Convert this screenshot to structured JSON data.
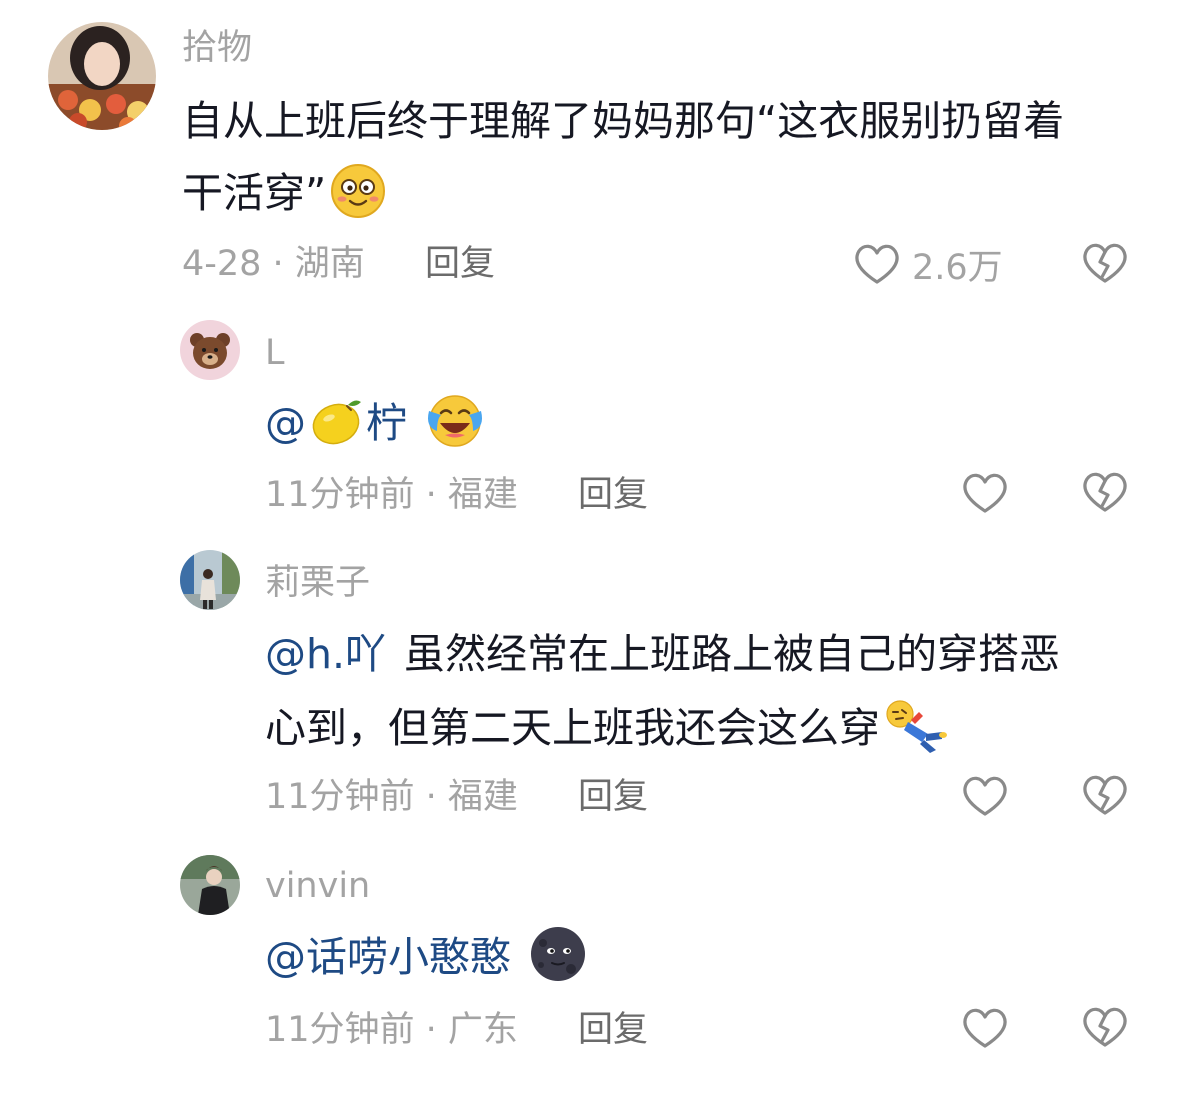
{
  "comments": [
    {
      "username": "拾物",
      "text_line1": "自从上班后终于理解了妈妈那句“这衣服别扔留着",
      "text_line2": "干活穿”",
      "text_emoji": "smiling-face-emoji",
      "meta": "4-28 · 湖南",
      "reply_label": "回复",
      "like_count": "2.6万"
    }
  ],
  "replies": [
    {
      "username": "L",
      "mention": "@",
      "mention_emoji": "lemon-emoji",
      "mention_name": "柠",
      "emoji": "laughing-crying-emoji",
      "meta": "11分钟前 · 福建",
      "reply_label": "回复"
    },
    {
      "username": "莉栗子",
      "mention": "@h.吖",
      "text_line1": "虽然经常在上班路上被自己的穿搭恶",
      "text_line2": "心到，但第二天上班我还会这么穿",
      "emoji": "lying-down-emoji",
      "meta": "11分钟前 · 福建",
      "reply_label": "回复"
    },
    {
      "username": "vinvin",
      "mention": "@话唠小憨憨",
      "emoji": "dark-moon-face-emoji",
      "meta": "11分钟前 · 广东",
      "reply_label": "回复"
    }
  ],
  "icons": {
    "like": "heart-outline-icon",
    "dislike": "broken-heart-icon"
  },
  "colors": {
    "text": "#161823",
    "secondary": "#a3a3a3",
    "mention": "#1e4a84",
    "reply": "#6b6b6b"
  }
}
